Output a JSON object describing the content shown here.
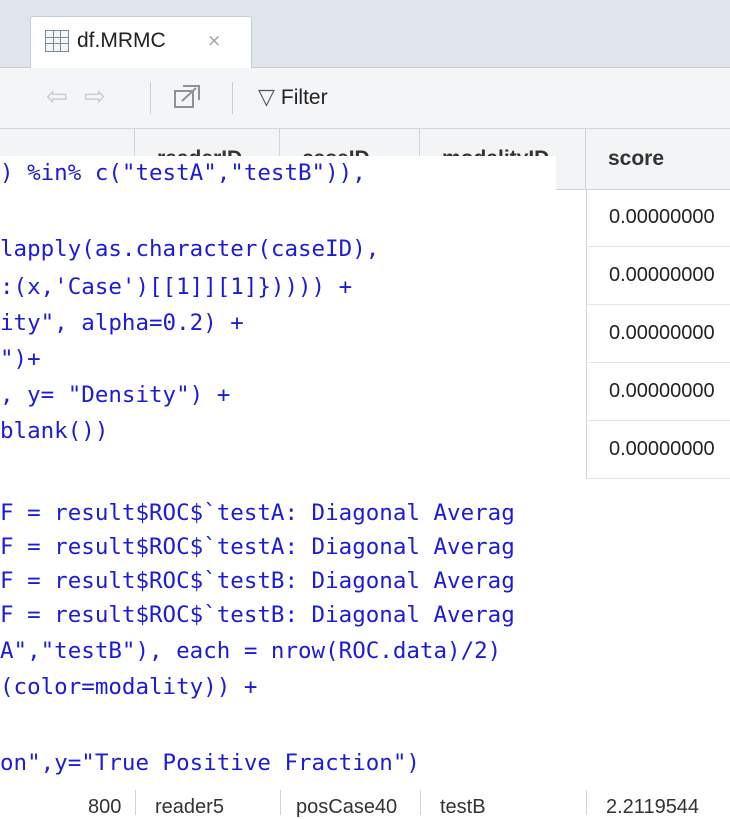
{
  "tab": {
    "label": "df.MRMC",
    "close": "×"
  },
  "toolbar": {
    "back": "⇦",
    "forward": "⇨",
    "filter_icon": "▽",
    "filter_label": "Filter"
  },
  "grid": {
    "headers": [
      "readerID",
      "caseID",
      "modalityID",
      "score"
    ],
    "score_values": [
      "0.00000000",
      "0.00000000",
      "0.00000000",
      "0.00000000",
      "0.00000000"
    ],
    "bottom_row": {
      "rownum": "800",
      "reader": "reader5",
      "case": "posCase40",
      "modality": "testB",
      "score": "2.2119544"
    }
  },
  "code_block_1": {
    "lines": [
      ") %in% c(\"testA\",\"testB\")),",
      "",
      "lapply(as.character(caseID),",
      ":(x,'Case')[[1]][1]})))) +",
      "ity\", alpha=0.2) +",
      "\")+",
      ", y= \"Density\") +",
      "blank())"
    ]
  },
  "code_block_2": {
    "lines": [
      "F = result$ROC$`testA: Diagonal Averag",
      "F = result$ROC$`testA: Diagonal Averag",
      "F = result$ROC$`testB: Diagonal Averag",
      "F = result$ROC$`testB: Diagonal Averag",
      "A\",\"testB\"), each = nrow(ROC.data)/2)",
      "(color=modality)) +",
      "",
      "on\",y=\"True Positive Fraction\")"
    ]
  }
}
